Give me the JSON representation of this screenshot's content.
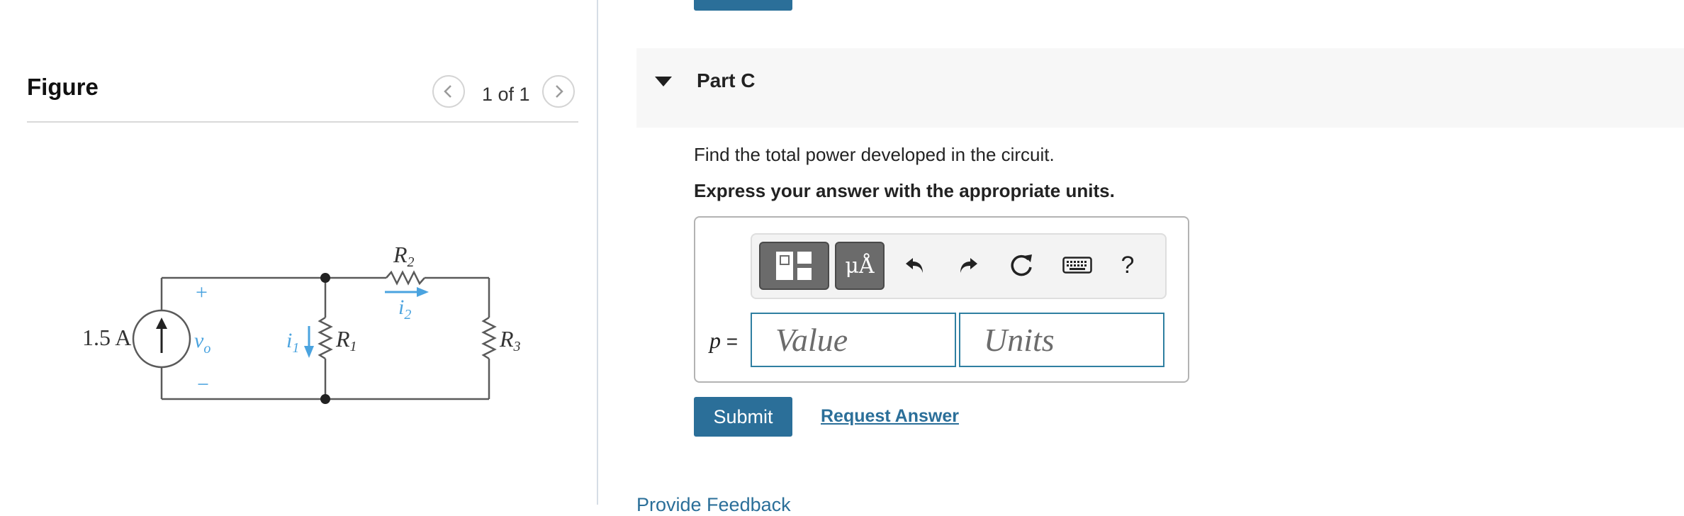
{
  "figure": {
    "title": "Figure",
    "pager": "1 of 1",
    "prev_icon": "chevron-left-icon",
    "next_icon": "chevron-right-icon",
    "circuit": {
      "source_label": "1.5 A",
      "vo_label": "v",
      "vo_subscript": "o",
      "plus": "+",
      "minus": "−",
      "r1_label": "R",
      "r1_sub": "1",
      "r2_label": "R",
      "r2_sub": "2",
      "r3_label": "R",
      "r3_sub": "3",
      "i1_label": "i",
      "i1_sub": "1",
      "i2_label": "i",
      "i2_sub": "2",
      "wire_color": "#5a5a5a",
      "accent_color": "#4aa3df"
    }
  },
  "part": {
    "label": "Part C",
    "question": "Find the total power developed in the circuit.",
    "instruction": "Express your answer with the appropriate units."
  },
  "toolbar": {
    "templates_icon": "templates-icon",
    "units_label": "μÅ",
    "undo_icon": "undo-icon",
    "redo_icon": "redo-icon",
    "reset_icon": "reset-icon",
    "keyboard_icon": "keyboard-icon",
    "help_label": "?"
  },
  "answer": {
    "variable": "p",
    "equals": " =",
    "value_placeholder": "Value",
    "units_placeholder": "Units"
  },
  "actions": {
    "submit_label": "Submit",
    "request_label": "Request Answer",
    "feedback_label": "Provide Feedback"
  },
  "colors": {
    "primary": "#2b6f99",
    "header_bg": "#f7f7f7",
    "field_border": "#2f7fa1"
  }
}
